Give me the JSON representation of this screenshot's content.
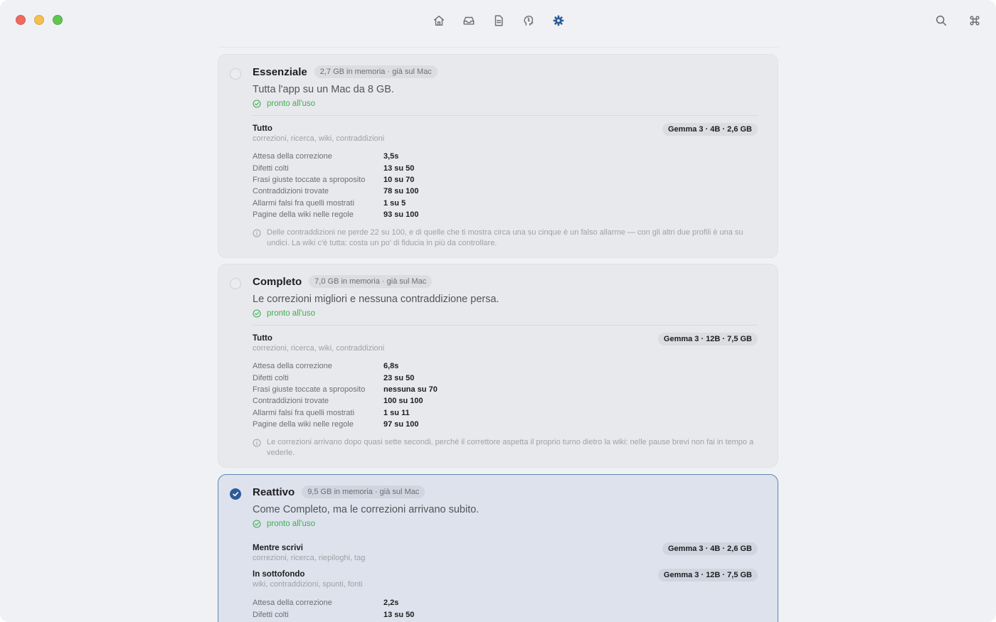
{
  "toolbar": {
    "items": [
      {
        "icon": "home-icon"
      },
      {
        "icon": "inbox-icon"
      },
      {
        "icon": "document-icon"
      },
      {
        "icon": "brain-icon"
      },
      {
        "icon": "gear-icon",
        "active": true
      }
    ],
    "right_items": [
      {
        "icon": "search-icon"
      },
      {
        "icon": "command-icon"
      }
    ],
    "accent_color": "#2d5b99"
  },
  "profiles": [
    {
      "title": "Essenziale",
      "memory": "2,7 GB in memoria · già sul Mac",
      "description": "Tutta l'app su un Mac da 8 GB.",
      "status": "pronto all'uso",
      "selected": false,
      "models": [
        {
          "name": "Tutto",
          "tasks": "correzioni, ricerca, wiki, contraddizioni",
          "model": "Gemma 3 · 4B · 2,6 GB"
        }
      ],
      "stats": [
        {
          "label": "Attesa della correzione",
          "value": "3,5s"
        },
        {
          "label": "Difetti colti",
          "value": "13 su 50"
        },
        {
          "label": "Frasi giuste toccate a sproposito",
          "value": "10 su 70"
        },
        {
          "label": "Contraddizioni trovate",
          "value": "78 su 100"
        },
        {
          "label": "Allarmi falsi fra quelli mostrati",
          "value": "1 su 5"
        },
        {
          "label": "Pagine della wiki nelle regole",
          "value": "93 su 100"
        }
      ],
      "note": "Delle contraddizioni ne perde 22 su 100, e di quelle che ti mostra circa una su cinque è un falso allarme — con gli altri due profili è una su undici. La wiki c'è tutta: costa un po' di fiducia in più da controllare."
    },
    {
      "title": "Completo",
      "memory": "7,0 GB in memoria · già sul Mac",
      "description": "Le correzioni migliori e nessuna contraddizione persa.",
      "status": "pronto all'uso",
      "selected": false,
      "models": [
        {
          "name": "Tutto",
          "tasks": "correzioni, ricerca, wiki, contraddizioni",
          "model": "Gemma 3 · 12B · 7,5 GB"
        }
      ],
      "stats": [
        {
          "label": "Attesa della correzione",
          "value": "6,8s"
        },
        {
          "label": "Difetti colti",
          "value": "23 su 50"
        },
        {
          "label": "Frasi giuste toccate a sproposito",
          "value": "nessuna su 70"
        },
        {
          "label": "Contraddizioni trovate",
          "value": "100 su 100"
        },
        {
          "label": "Allarmi falsi fra quelli mostrati",
          "value": "1 su 11"
        },
        {
          "label": "Pagine della wiki nelle regole",
          "value": "97 su 100"
        }
      ],
      "note": "Le correzioni arrivano dopo quasi sette secondi, perché il correttore aspetta il proprio turno dietro la wiki: nelle pause brevi non fai in tempo a vederle."
    },
    {
      "title": "Reattivo",
      "memory": "9,5 GB in memoria · già sul Mac",
      "description": "Come Completo, ma le correzioni arrivano subito.",
      "status": "pronto all'uso",
      "selected": true,
      "models": [
        {
          "name": "Mentre scrivi",
          "tasks": "correzioni, ricerca, riepiloghi, tag",
          "model": "Gemma 3 · 4B · 2,6 GB"
        },
        {
          "name": "In sottofondo",
          "tasks": "wiki, contraddizioni, spunti, fonti",
          "model": "Gemma 3 · 12B · 7,5 GB"
        }
      ],
      "stats": [
        {
          "label": "Attesa della correzione",
          "value": "2,2s"
        },
        {
          "label": "Difetti colti",
          "value": "13 su 50"
        }
      ]
    }
  ]
}
